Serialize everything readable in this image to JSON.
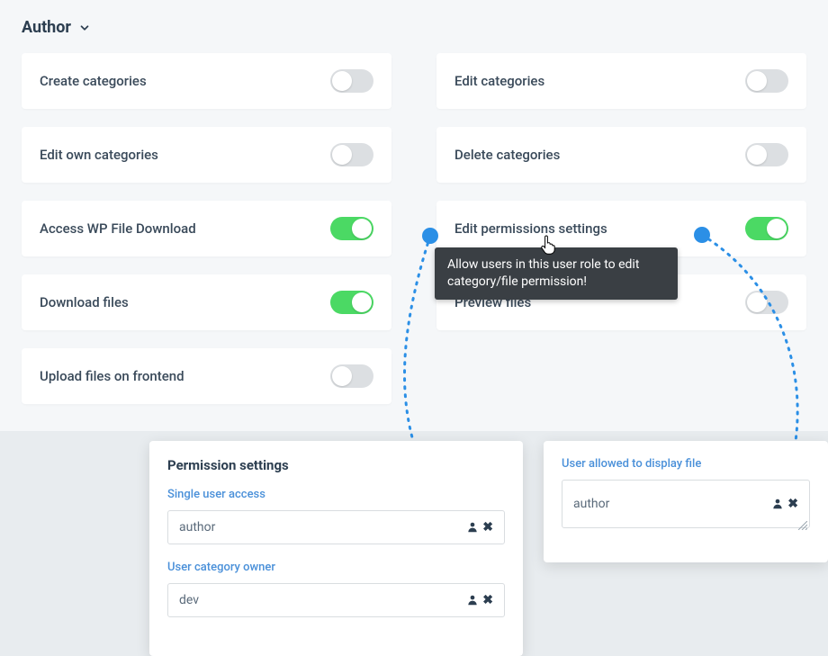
{
  "role": {
    "label": "Author"
  },
  "perms": [
    {
      "label": "Create categories",
      "on": false
    },
    {
      "label": "Edit categories",
      "on": false
    },
    {
      "label": "Edit own categories",
      "on": false
    },
    {
      "label": "Delete categories",
      "on": false
    },
    {
      "label": "Access WP File Download",
      "on": true
    },
    {
      "label": "Edit permissions settings",
      "on": true
    },
    {
      "label": "Download files",
      "on": true
    },
    {
      "label": "Preview files",
      "on": false
    },
    {
      "label": "Upload files on frontend",
      "on": false
    }
  ],
  "tooltip": "Allow users in this user role to edit category/file permission!",
  "panel1": {
    "title": "Permission settings",
    "single_user_label": "Single user access",
    "single_user_value": "author",
    "owner_label": "User category owner",
    "owner_value": "dev"
  },
  "panel2": {
    "title": "User allowed to display file",
    "value": "author"
  }
}
